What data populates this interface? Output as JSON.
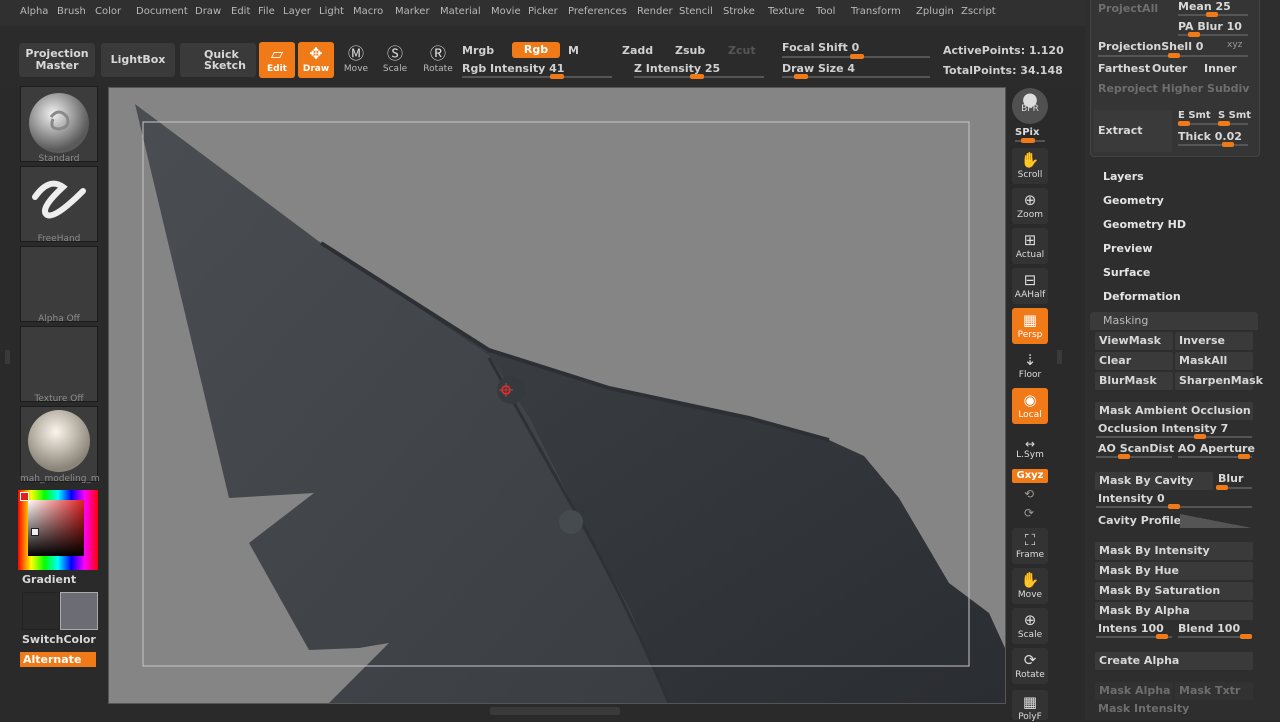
{
  "menu": [
    "Alpha",
    "Brush",
    "Color",
    "Document",
    "Draw",
    "Edit",
    "File",
    "Layer",
    "Light",
    "Macro",
    "Marker",
    "Material",
    "Movie",
    "Picker",
    "Preferences",
    "Render",
    "Stencil",
    "Stroke",
    "Texture",
    "Tool",
    "Transform",
    "Zplugin",
    "Zscript"
  ],
  "toolbar": {
    "projection_master": "Projection Master",
    "lightbox": "LightBox",
    "quick_sketch": "Quick Sketch",
    "edit": "Edit",
    "draw": "Draw",
    "move": "Move",
    "scale": "Scale",
    "rotate": "Rotate",
    "mrgb": "Mrgb",
    "rgb": "Rgb",
    "m": "M",
    "rgb_intensity_label": "Rgb Intensity",
    "rgb_intensity_value": "41",
    "zadd": "Zadd",
    "zsub": "Zsub",
    "zcut": "Zcut",
    "z_intensity_label": "Z Intensity",
    "z_intensity_value": "25",
    "focal_shift_label": "Focal Shift",
    "focal_shift_value": "0",
    "draw_size_label": "Draw Size",
    "draw_size_value": "4",
    "active_points": "ActivePoints: 1.120",
    "total_points": "TotalPoints: 34.148"
  },
  "left_shelf": {
    "brush": "Standard",
    "stroke": "FreeHand",
    "alpha": "Alpha  Off",
    "texture": "Texture  Off",
    "material": "mah_modeling_m",
    "gradient": "Gradient",
    "switch_color": "SwitchColor",
    "alternate": "Alternate"
  },
  "right_bar": {
    "bpr": "BPR",
    "spix": "SPix",
    "scroll": "Scroll",
    "zoom": "Zoom",
    "actual": "Actual",
    "aahalf": "AAHalf",
    "persp": "Persp",
    "floor": "Floor",
    "local": "Local",
    "lsym": "L.Sym",
    "xyz": "Gxyz",
    "frame": "Frame",
    "move": "Move",
    "scale": "Scale",
    "rotate": "Rotate",
    "polyf": "PolyF"
  },
  "palette": {
    "project_all": "ProjectAll",
    "mean": "Mean 25",
    "pa_blur": "PA Blur 10",
    "projection_shell": "ProjectionShell 0",
    "farthest": "Farthest",
    "outer": "Outer",
    "inner": "Inner",
    "reproject": "Reproject Higher Subdiv",
    "extract": "Extract",
    "e_smt": "E Smt",
    "s_smt": "S Smt",
    "thick": "Thick 0.02",
    "sections": [
      "Layers",
      "Geometry",
      "Geometry HD",
      "Preview",
      "Surface",
      "Deformation"
    ],
    "masking_title": "Masking",
    "view_mask": "ViewMask",
    "inverse": "Inverse",
    "clear": "Clear",
    "mask_all": "MaskAll",
    "blur_mask": "BlurMask",
    "sharpen_mask": "SharpenMask",
    "mask_ambient_occlusion": "Mask Ambient Occlusion",
    "occlusion_intensity": "Occlusion Intensity 7",
    "ao_scandist": "AO ScanDist",
    "ao_aperture": "AO Aperture",
    "mask_by_cavity": "Mask By Cavity",
    "blur": "Blur",
    "intensity": "Intensity 0",
    "cavity_profile": "Cavity Profile",
    "mask_by_intensity": "Mask By Intensity",
    "mask_by_hue": "Mask By Hue",
    "mask_by_saturation": "Mask By Saturation",
    "mask_by_alpha": "Mask By Alpha",
    "intens": "Intens 100",
    "blend": "Blend 100",
    "create_alpha": "Create Alpha",
    "mask_alpha": "Mask Alpha",
    "mask_txtr": "Mask Txtr",
    "mask_intensity": "Mask Intensity"
  },
  "colors": {
    "accent": "#f07a18",
    "panel": "#2e2e2e",
    "canvas": "#858585"
  }
}
